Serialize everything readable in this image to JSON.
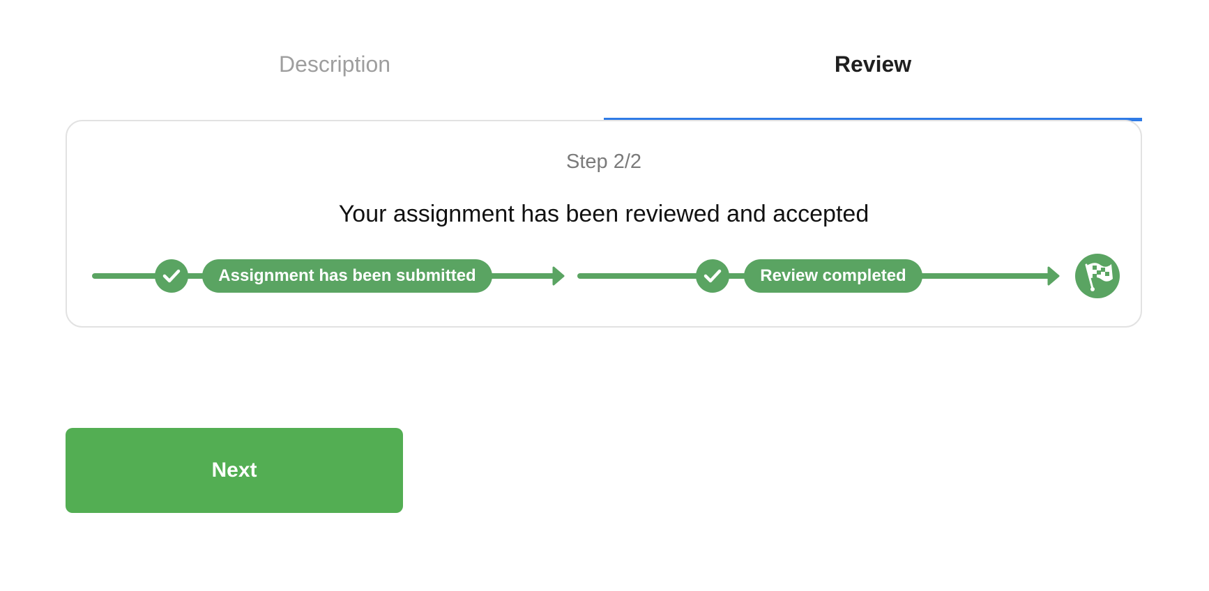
{
  "tabs": {
    "description_label": "Description",
    "review_label": "Review",
    "active": "Review"
  },
  "card": {
    "step_label": "Step 2/2",
    "status_title": "Your assignment has been reviewed and accepted"
  },
  "timeline": {
    "stages": [
      {
        "label": "Assignment has been submitted",
        "status": "completed",
        "icon": "check-icon"
      },
      {
        "label": "Review completed",
        "status": "completed",
        "icon": "check-icon"
      }
    ],
    "finish_icon": "checkered-flag-icon"
  },
  "actions": {
    "next_label": "Next"
  },
  "colors": {
    "active_tab_underline": "#2f7be6",
    "timeline_green": "#5aa462",
    "button_green": "#53ae53",
    "inactive_tab_text": "#9e9e9e"
  }
}
